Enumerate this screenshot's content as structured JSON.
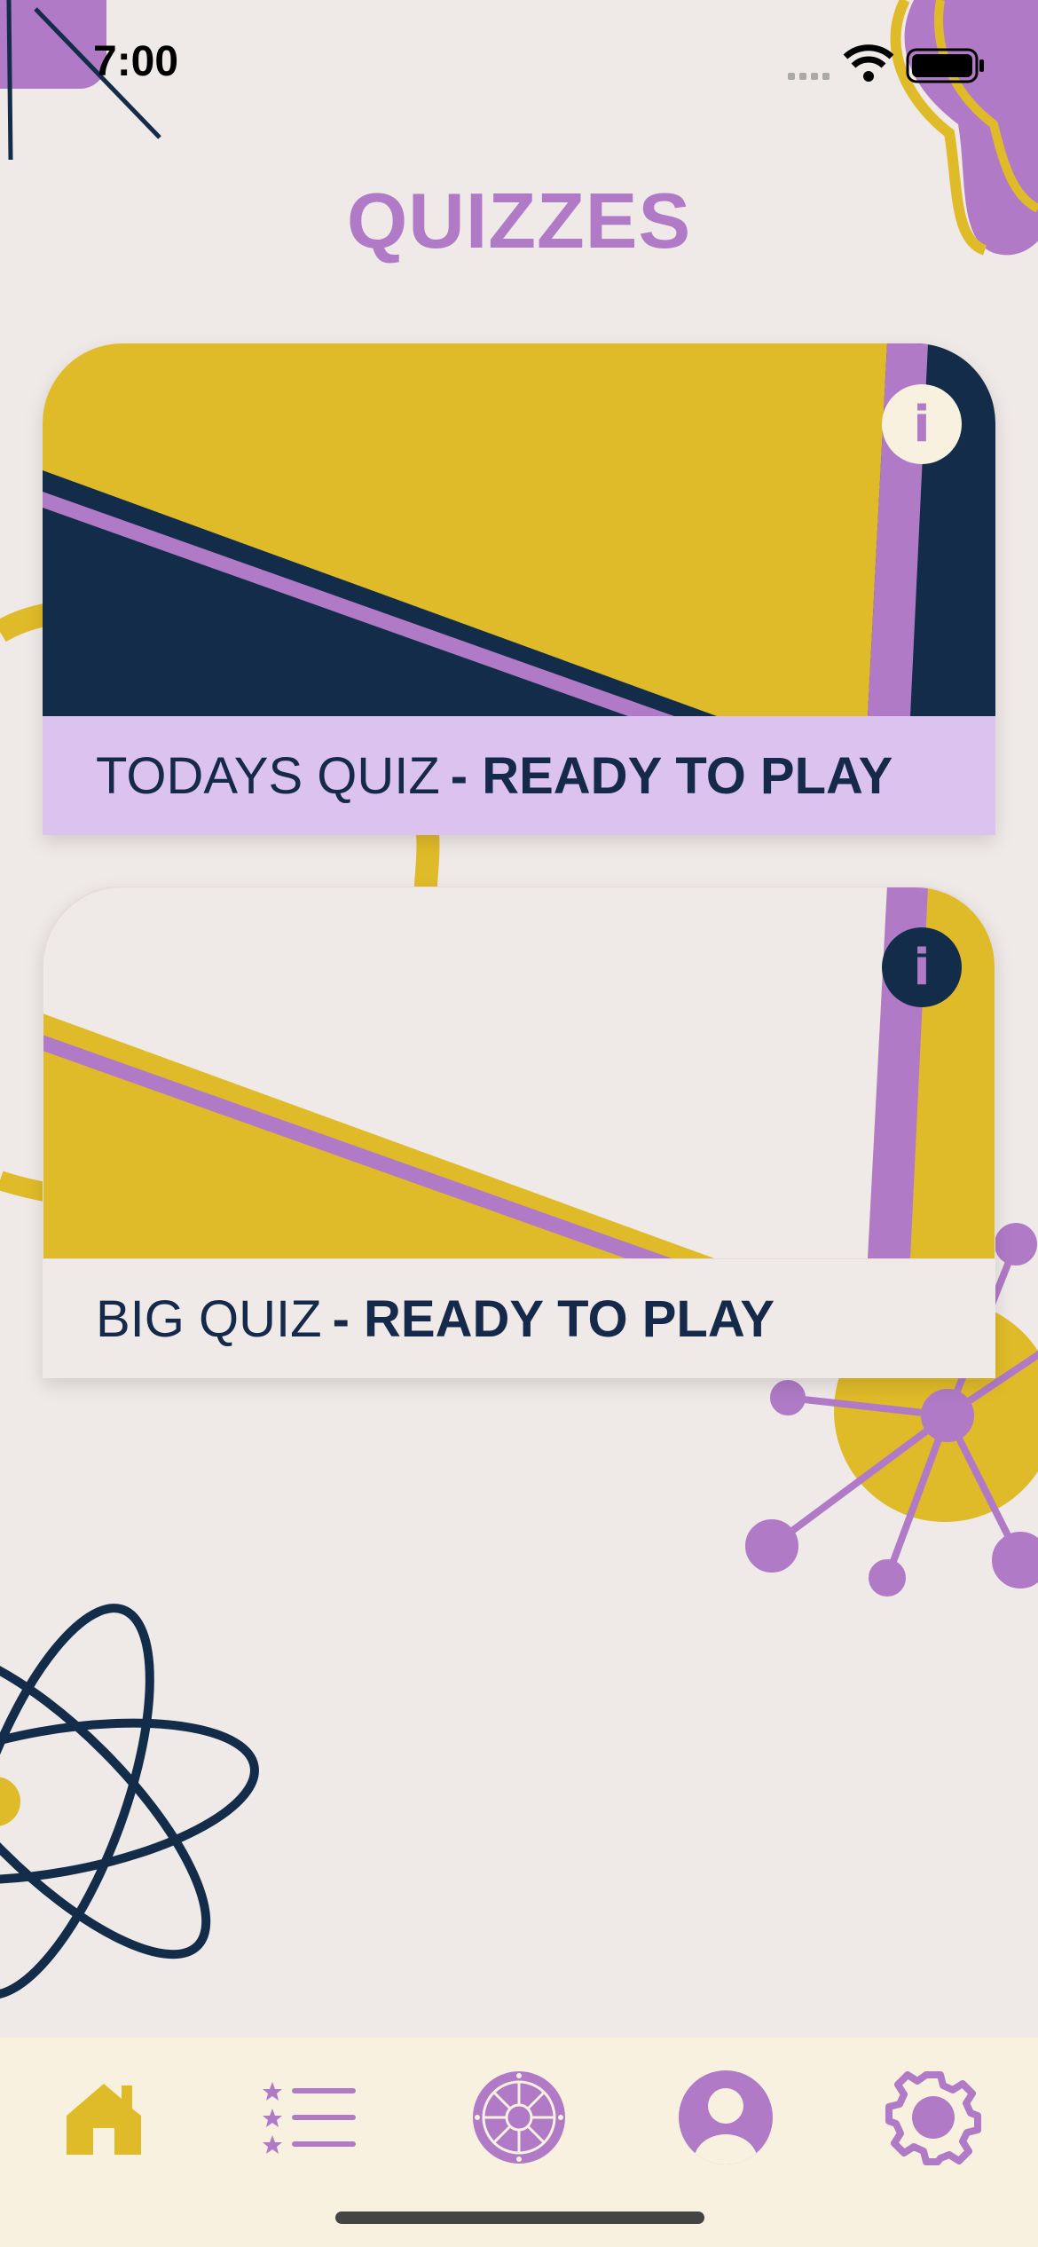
{
  "status_bar": {
    "time": "7:00",
    "icons": [
      "signal-icon",
      "wifi-icon",
      "battery-icon"
    ]
  },
  "page": {
    "title": "QUIZZES"
  },
  "quizzes": [
    {
      "name": "TODAYS QUIZ",
      "status": "- READY TO PLAY",
      "info_icon": "i",
      "theme": "yellow-navy"
    },
    {
      "name": "BIG QUIZ",
      "status": "- READY TO PLAY",
      "info_icon": "i",
      "theme": "light-yellow"
    }
  ],
  "tab_bar": {
    "items": [
      "home-icon",
      "leaderboard-icon",
      "wheel-icon",
      "profile-icon",
      "settings-icon"
    ],
    "active": "home-icon"
  },
  "colors": {
    "purple": "#b07ac6",
    "yellow": "#e0bb29",
    "navy": "#122c4a",
    "lavender": "#dcc3ef",
    "background": "#efe9e8",
    "tab_bar": "#f8f1e0"
  }
}
